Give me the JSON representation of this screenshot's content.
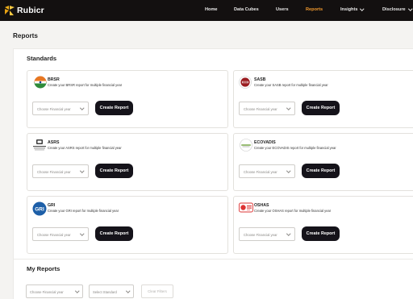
{
  "app": {
    "name": "Rubicr"
  },
  "nav": [
    {
      "label": "Home",
      "active": false
    },
    {
      "label": "Data Cubes",
      "active": false
    },
    {
      "label": "Users",
      "active": false
    },
    {
      "label": "Reports",
      "active": true
    },
    {
      "label": "Insights",
      "active": false,
      "dropdown": true
    },
    {
      "label": "Disclosure",
      "active": false,
      "dropdown": true
    }
  ],
  "page": {
    "title": "Reports"
  },
  "standards": {
    "title": "Standards",
    "cards": [
      {
        "name": "BRSR",
        "description": "Create your BRSR report for multiple financial year",
        "select_placeholder": "Choose Financial year",
        "button": "Create Report",
        "icon": "brsr-logo-icon"
      },
      {
        "name": "SASB",
        "description": "Create your SASB report for multiple financial year",
        "select_placeholder": "Choose Financial year",
        "button": "Create Report",
        "icon": "sasb-logo-icon"
      },
      {
        "name": "ASRS",
        "description": "Create your ASRS report for multiple financial year",
        "select_placeholder": "Choose Financial year",
        "button": "Create Report",
        "icon": "asrs-logo-icon"
      },
      {
        "name": "ECOVADIS",
        "description": "Create your ECOVADIS report for multiple financial year",
        "select_placeholder": "Choose Financial year",
        "button": "Create Report",
        "icon": "ecovadis-logo-icon"
      },
      {
        "name": "GRI",
        "description": "Create your GRI report for multiple financial year",
        "select_placeholder": "Choose Financial year",
        "button": "Create Report",
        "icon": "gri-logo-icon",
        "logo_text": "GRI"
      },
      {
        "name": "OSHAS",
        "description": "Create your OSHAS report for multiple financial year",
        "select_placeholder": "Choose Financial year",
        "button": "Create Report",
        "icon": "oshas-logo-icon"
      }
    ]
  },
  "my_reports": {
    "title": "My Reports",
    "financial_year_placeholder": "Choose Financial year",
    "standard_placeholder": "Select Standard",
    "clear_button": "Clear Filters"
  },
  "colors": {
    "topbar": "#131010",
    "accent": "#f29a2e",
    "button": "#15131a",
    "gri_blue": "#1d5fa8"
  }
}
